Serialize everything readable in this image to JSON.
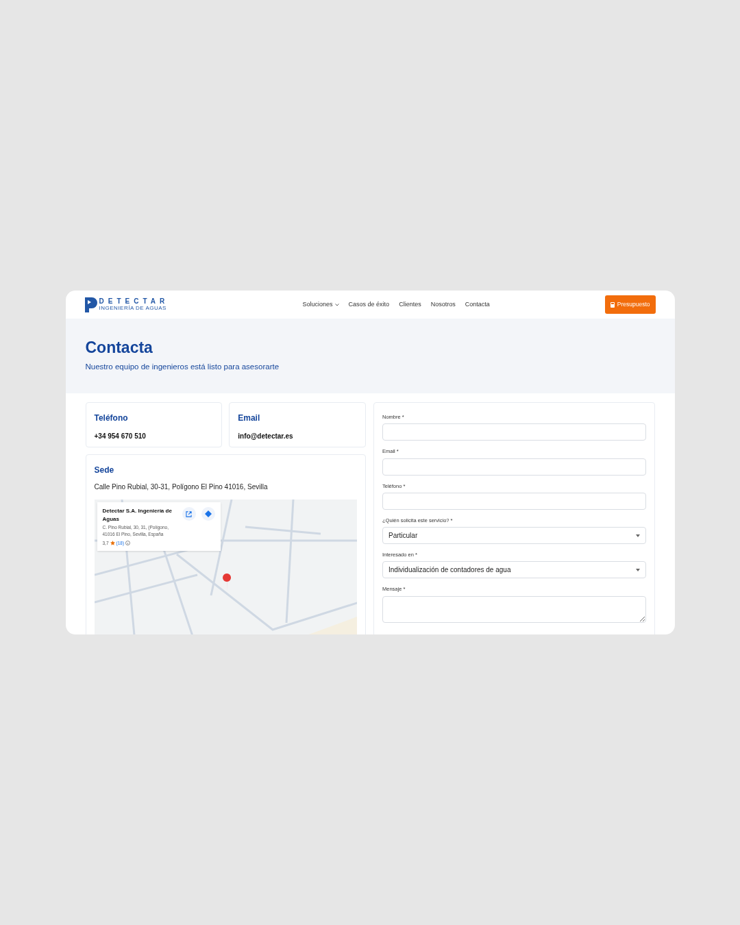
{
  "logo": {
    "name": "DETECTAR",
    "tagline": "INGENIERÍA DE AGUAS"
  },
  "nav": [
    {
      "label": "Soluciones",
      "dropdown": true
    },
    {
      "label": "Casos de éxito",
      "dropdown": false
    },
    {
      "label": "Clientes",
      "dropdown": false
    },
    {
      "label": "Nosotros",
      "dropdown": false
    },
    {
      "label": "Contacta",
      "dropdown": false
    }
  ],
  "cta_button": "Presupuesto",
  "hero": {
    "title": "Contacta",
    "subtitle": "Nuestro equipo de ingenieros está listo para asesorarte"
  },
  "contact_cards": [
    {
      "title": "Teléfono",
      "value": "+34 954 670 510"
    },
    {
      "title": "Email",
      "value": "info@detectar.es"
    }
  ],
  "sede": {
    "title": "Sede",
    "address": "Calle Pino Rubial, 30-31, Polígono El Pino 41016, Sevilla",
    "map_card": {
      "name": "Detectar S.A. Ingeniería de Aguas",
      "address": "C. Pino Rubial, 30, 31, (Polígono, 41016 El Pino, Sevilla, España",
      "rating": "3,7",
      "reviews": "(18)"
    }
  },
  "form": {
    "fields": [
      {
        "kind": "text",
        "label": "Nombre *"
      },
      {
        "kind": "text",
        "label": "Email *"
      },
      {
        "kind": "text",
        "label": "Teléfono *"
      },
      {
        "kind": "select",
        "label": "¿Quién solicita este servicio? *",
        "value": "Particular"
      },
      {
        "kind": "select",
        "label": "Interesado en *",
        "value": "Individualización de contadores de agua"
      },
      {
        "kind": "textarea",
        "label": "Mensaje *"
      }
    ]
  }
}
